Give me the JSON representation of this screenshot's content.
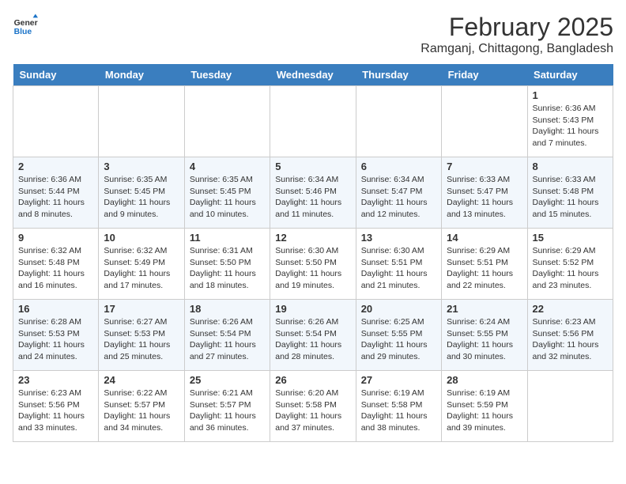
{
  "header": {
    "logo_line1": "General",
    "logo_line2": "Blue",
    "title": "February 2025",
    "subtitle": "Ramganj, Chittagong, Bangladesh"
  },
  "calendar": {
    "days_of_week": [
      "Sunday",
      "Monday",
      "Tuesday",
      "Wednesday",
      "Thursday",
      "Friday",
      "Saturday"
    ],
    "weeks": [
      [
        {
          "day": "",
          "info": ""
        },
        {
          "day": "",
          "info": ""
        },
        {
          "day": "",
          "info": ""
        },
        {
          "day": "",
          "info": ""
        },
        {
          "day": "",
          "info": ""
        },
        {
          "day": "",
          "info": ""
        },
        {
          "day": "1",
          "info": "Sunrise: 6:36 AM\nSunset: 5:43 PM\nDaylight: 11 hours and 7 minutes."
        }
      ],
      [
        {
          "day": "2",
          "info": "Sunrise: 6:36 AM\nSunset: 5:44 PM\nDaylight: 11 hours and 8 minutes."
        },
        {
          "day": "3",
          "info": "Sunrise: 6:35 AM\nSunset: 5:45 PM\nDaylight: 11 hours and 9 minutes."
        },
        {
          "day": "4",
          "info": "Sunrise: 6:35 AM\nSunset: 5:45 PM\nDaylight: 11 hours and 10 minutes."
        },
        {
          "day": "5",
          "info": "Sunrise: 6:34 AM\nSunset: 5:46 PM\nDaylight: 11 hours and 11 minutes."
        },
        {
          "day": "6",
          "info": "Sunrise: 6:34 AM\nSunset: 5:47 PM\nDaylight: 11 hours and 12 minutes."
        },
        {
          "day": "7",
          "info": "Sunrise: 6:33 AM\nSunset: 5:47 PM\nDaylight: 11 hours and 13 minutes."
        },
        {
          "day": "8",
          "info": "Sunrise: 6:33 AM\nSunset: 5:48 PM\nDaylight: 11 hours and 15 minutes."
        }
      ],
      [
        {
          "day": "9",
          "info": "Sunrise: 6:32 AM\nSunset: 5:48 PM\nDaylight: 11 hours and 16 minutes."
        },
        {
          "day": "10",
          "info": "Sunrise: 6:32 AM\nSunset: 5:49 PM\nDaylight: 11 hours and 17 minutes."
        },
        {
          "day": "11",
          "info": "Sunrise: 6:31 AM\nSunset: 5:50 PM\nDaylight: 11 hours and 18 minutes."
        },
        {
          "day": "12",
          "info": "Sunrise: 6:30 AM\nSunset: 5:50 PM\nDaylight: 11 hours and 19 minutes."
        },
        {
          "day": "13",
          "info": "Sunrise: 6:30 AM\nSunset: 5:51 PM\nDaylight: 11 hours and 21 minutes."
        },
        {
          "day": "14",
          "info": "Sunrise: 6:29 AM\nSunset: 5:51 PM\nDaylight: 11 hours and 22 minutes."
        },
        {
          "day": "15",
          "info": "Sunrise: 6:29 AM\nSunset: 5:52 PM\nDaylight: 11 hours and 23 minutes."
        }
      ],
      [
        {
          "day": "16",
          "info": "Sunrise: 6:28 AM\nSunset: 5:53 PM\nDaylight: 11 hours and 24 minutes."
        },
        {
          "day": "17",
          "info": "Sunrise: 6:27 AM\nSunset: 5:53 PM\nDaylight: 11 hours and 25 minutes."
        },
        {
          "day": "18",
          "info": "Sunrise: 6:26 AM\nSunset: 5:54 PM\nDaylight: 11 hours and 27 minutes."
        },
        {
          "day": "19",
          "info": "Sunrise: 6:26 AM\nSunset: 5:54 PM\nDaylight: 11 hours and 28 minutes."
        },
        {
          "day": "20",
          "info": "Sunrise: 6:25 AM\nSunset: 5:55 PM\nDaylight: 11 hours and 29 minutes."
        },
        {
          "day": "21",
          "info": "Sunrise: 6:24 AM\nSunset: 5:55 PM\nDaylight: 11 hours and 30 minutes."
        },
        {
          "day": "22",
          "info": "Sunrise: 6:23 AM\nSunset: 5:56 PM\nDaylight: 11 hours and 32 minutes."
        }
      ],
      [
        {
          "day": "23",
          "info": "Sunrise: 6:23 AM\nSunset: 5:56 PM\nDaylight: 11 hours and 33 minutes."
        },
        {
          "day": "24",
          "info": "Sunrise: 6:22 AM\nSunset: 5:57 PM\nDaylight: 11 hours and 34 minutes."
        },
        {
          "day": "25",
          "info": "Sunrise: 6:21 AM\nSunset: 5:57 PM\nDaylight: 11 hours and 36 minutes."
        },
        {
          "day": "26",
          "info": "Sunrise: 6:20 AM\nSunset: 5:58 PM\nDaylight: 11 hours and 37 minutes."
        },
        {
          "day": "27",
          "info": "Sunrise: 6:19 AM\nSunset: 5:58 PM\nDaylight: 11 hours and 38 minutes."
        },
        {
          "day": "28",
          "info": "Sunrise: 6:19 AM\nSunset: 5:59 PM\nDaylight: 11 hours and 39 minutes."
        },
        {
          "day": "",
          "info": ""
        }
      ]
    ]
  }
}
